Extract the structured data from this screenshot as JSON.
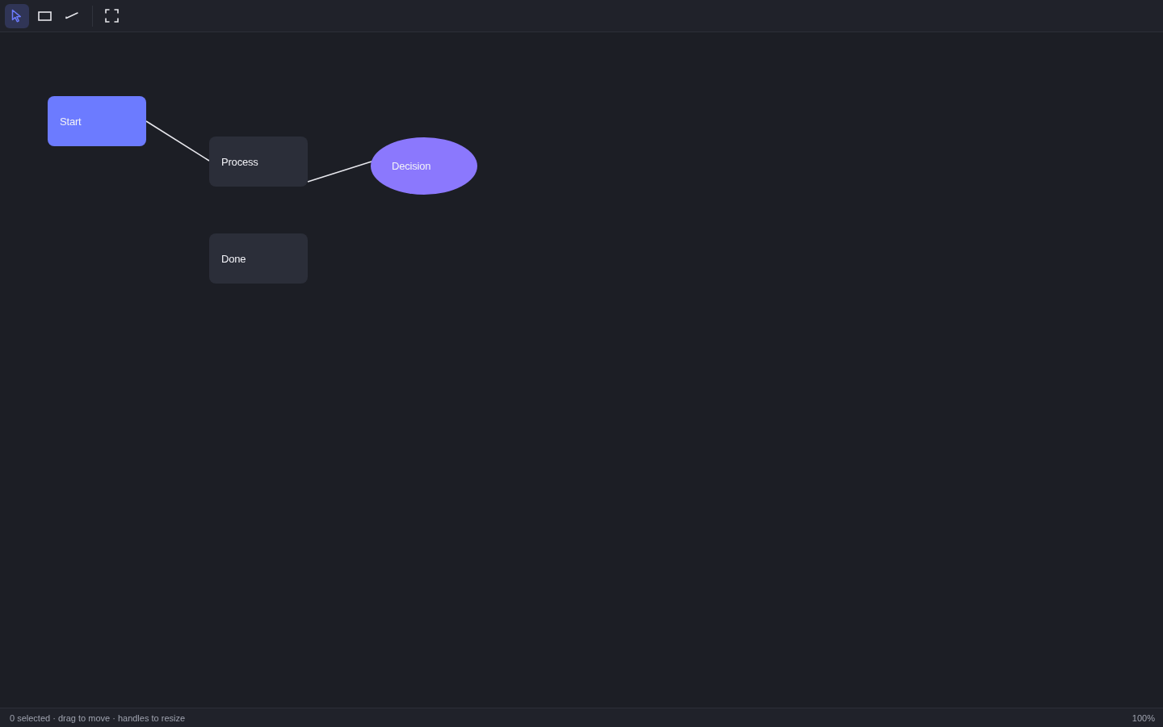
{
  "toolbar": {
    "tools": [
      {
        "kind": "select",
        "selected": true
      },
      {
        "kind": "rectangle",
        "selected": false
      },
      {
        "kind": "line",
        "selected": false
      }
    ],
    "actions": [
      {
        "kind": "fullscreen"
      }
    ]
  },
  "canvas": {
    "nodes": [
      {
        "label": "Start",
        "kind": "rect",
        "color": "#6c7bff"
      },
      {
        "label": "Process",
        "kind": "rect",
        "color": "#2b2e39"
      },
      {
        "label": "Decision",
        "kind": "ellipse",
        "color": "#8b78fd"
      },
      {
        "label": "Done",
        "kind": "rect",
        "color": "#2b2e39"
      }
    ]
  },
  "status_bar": {
    "hint": "0 selected · drag to move · handles to resize",
    "zoom": "100%"
  }
}
